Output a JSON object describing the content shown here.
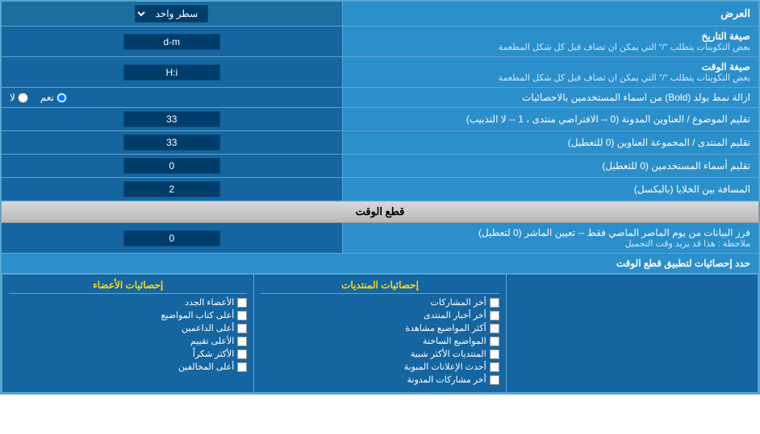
{
  "page": {
    "title": "العرض",
    "sections": {
      "display": {
        "label": "العرض",
        "row_type_label": "سطر واحد",
        "date_format_label": "صيغة التاريخ",
        "date_format_sublabel": "بعض التكوينات يتطلب \"/\" التي يمكن ان تضاف قبل كل شكل المطعمة",
        "date_format_value": "d-m",
        "time_format_label": "صيغة الوقت",
        "time_format_sublabel": "بعض التكوينات يتطلب \"/\" التي يمكن ان تضاف قبل كل شكل المطعمة",
        "time_format_value": "H:i",
        "bold_label": "ازالة نمط بولد (Bold) من اسماء المستخدمين بالاحصائيات",
        "bold_yes": "نعم",
        "bold_no": "لا",
        "subject_order_label": "تقليم الموضوع / العناوين المدونة (0 -- الافتراضي منتدى ، 1 -- لا التذبيب)",
        "subject_order_value": "33",
        "forum_trim_label": "تقليم المنتدى / المجموعة العناوين (0 للتعطيل)",
        "forum_trim_value": "33",
        "usernames_trim_label": "تقليم أسماء المستخدمين (0 للتعطيل)",
        "usernames_trim_value": "0",
        "cell_spacing_label": "المسافة بين الخلايا (بالبكسل)",
        "cell_spacing_value": "2"
      },
      "realtime": {
        "title": "قطع الوقت",
        "filter_label": "فرز البيانات من يوم الماضر الماضي فقط -- تعيين الماشر (0 لتعطيل)",
        "filter_sublabel": "ملاحظة : هذا قد يزيد وقت التحميل",
        "filter_value": "0",
        "stats_apply_label": "حدد إحصائيات لتطبيق قطع الوقت"
      }
    },
    "stats_columns": {
      "posts": {
        "header": "إحصائيات المنتديات",
        "items": [
          "أخر المشاركات",
          "أخر أخبار المنتدى",
          "أكثر المواضيع مشاهدة",
          "المواضيع الساخنة",
          "المنتديات الأكثر شبية",
          "أحدث الإعلانات المبوبة",
          "أخر مشاركات المدونة"
        ]
      },
      "members": {
        "header": "إحصائيات الأعضاء",
        "items": [
          "الأعضاء الجدد",
          "أعلى كتاب المواضيع",
          "أعلى الداعمين",
          "الأعلى تقييم",
          "الأكثر شكراً",
          "أعلى المخالفين"
        ]
      }
    }
  }
}
